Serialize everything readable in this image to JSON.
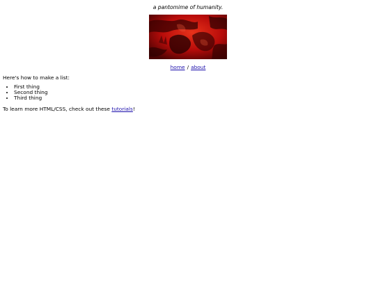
{
  "header": {
    "tagline": "a pantomime of humanity."
  },
  "banner": {
    "image_name": "red-figure-photo",
    "accent_color": "#c0140f"
  },
  "nav": {
    "links": [
      {
        "label": "home"
      },
      {
        "label": "about"
      }
    ],
    "separator": "/"
  },
  "content": {
    "intro": "Here's how to make a list:",
    "list": [
      {
        "label": "First thing"
      },
      {
        "label": "Second thing"
      },
      {
        "label": "Third thing"
      }
    ],
    "outro_prefix": "To learn more HTML/CSS, check out these ",
    "outro_link": "tutorials",
    "outro_suffix": "!"
  }
}
